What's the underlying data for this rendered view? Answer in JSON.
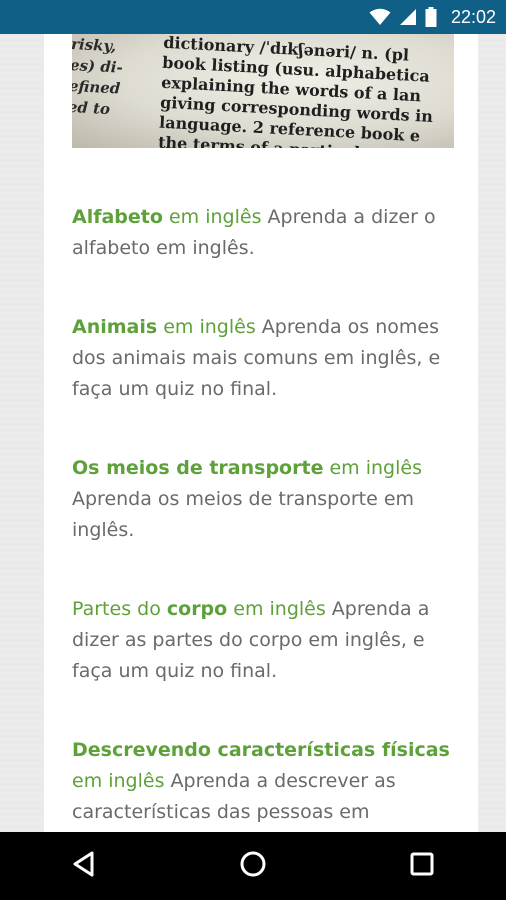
{
  "status_bar": {
    "time": "22:02"
  },
  "hero": {
    "left_lines": [
      "risky,",
      "es) di-",
      "efined",
      "ed  to"
    ],
    "right_lines": [
      "dictionary /ˈdɪkʃənəri/ n. (pl",
      "book listing (usu. alphabetica",
      "explaining the words of a lan",
      "giving corresponding words in",
      "language. 2 reference book e",
      "the terms of a particula"
    ]
  },
  "items": [
    {
      "link_segments": [
        {
          "text": "Alfabeto",
          "bold": true
        },
        {
          "text": " em inglês",
          "bold": false
        }
      ],
      "description": " Aprenda a dizer o alfabeto em inglês."
    },
    {
      "link_segments": [
        {
          "text": "Animais",
          "bold": true
        },
        {
          "text": " em inglês",
          "bold": false
        }
      ],
      "description": " Aprenda os nomes dos animais mais comuns em inglês, e faça um quiz no final."
    },
    {
      "link_segments": [
        {
          "text": "Os meios de transporte",
          "bold": true
        },
        {
          "text": " em inglês",
          "bold": false
        }
      ],
      "description": " Aprenda os meios de transporte em inglês."
    },
    {
      "link_segments": [
        {
          "text": "Partes do ",
          "bold": false
        },
        {
          "text": "corpo",
          "bold": true
        },
        {
          "text": " em inglês",
          "bold": false
        }
      ],
      "description": " Aprenda a dizer as partes do corpo em inglês, e faça um quiz no final."
    },
    {
      "link_segments": [
        {
          "text": "Descrevendo características físicas",
          "bold": true
        },
        {
          "text": " em inglês",
          "bold": false
        }
      ],
      "description": " Aprenda a descrever as características das pessoas em"
    }
  ],
  "icons": {
    "wifi": "wifi-icon",
    "signal": "cell-signal-icon",
    "battery": "battery-icon",
    "back": "back-triangle-icon",
    "home": "home-circle-icon",
    "recents": "recents-square-icon"
  }
}
